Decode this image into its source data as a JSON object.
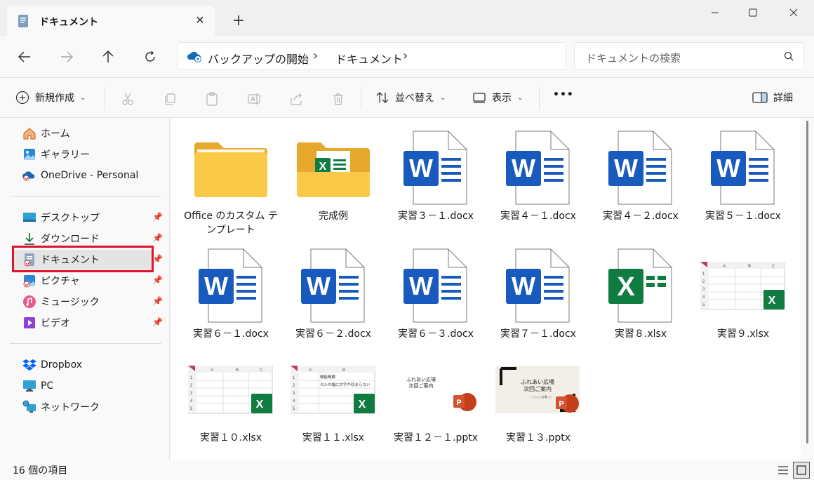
{
  "window": {
    "tab_title": "ドキュメント",
    "tab_close": "✕",
    "new_tab": "+"
  },
  "nav": {
    "breadcrumb": [
      "バックアップの開始",
      "ドキュメント"
    ],
    "search_placeholder": "ドキュメントの検索"
  },
  "toolbar": {
    "new_label": "新規作成",
    "sort_label": "並べ替え",
    "view_label": "表示",
    "more_label": "•••",
    "details_label": "詳細"
  },
  "sidebar": {
    "top": [
      {
        "label": "ホーム",
        "icon": "home-icon"
      },
      {
        "label": "ギャラリー",
        "icon": "gallery-icon"
      },
      {
        "label": "OneDrive - Personal",
        "icon": "onedrive-icon"
      }
    ],
    "pinned": [
      {
        "label": "デスクトップ",
        "icon": "desktop-icon"
      },
      {
        "label": "ダウンロード",
        "icon": "download-icon"
      },
      {
        "label": "ドキュメント",
        "icon": "documents-icon"
      },
      {
        "label": "ピクチャ",
        "icon": "pictures-icon"
      },
      {
        "label": "ミュージック",
        "icon": "music-icon"
      },
      {
        "label": "ビデオ",
        "icon": "video-icon"
      }
    ],
    "bottom": [
      {
        "label": "Dropbox",
        "icon": "dropbox-icon"
      },
      {
        "label": "PC",
        "icon": "pc-icon"
      },
      {
        "label": "ネットワーク",
        "icon": "network-icon"
      }
    ],
    "selected": "ドキュメント"
  },
  "files": [
    {
      "name": "Office のカスタム テンプレート",
      "type": "folder"
    },
    {
      "name": "完成例",
      "type": "folder-excel"
    },
    {
      "name": "実習３－１.docx",
      "type": "word"
    },
    {
      "name": "実習４－１.docx",
      "type": "word"
    },
    {
      "name": "実習４－２.docx",
      "type": "word"
    },
    {
      "name": "実習５－１.docx",
      "type": "word"
    },
    {
      "name": "実習６－１.docx",
      "type": "word"
    },
    {
      "name": "実習６－２.docx",
      "type": "word"
    },
    {
      "name": "実習６－３.docx",
      "type": "word"
    },
    {
      "name": "実習７－１.docx",
      "type": "word"
    },
    {
      "name": "実習８.xlsx",
      "type": "excel"
    },
    {
      "name": "実習９.xlsx",
      "type": "excel-thumb"
    },
    {
      "name": "実習１０.xlsx",
      "type": "excel-thumb"
    },
    {
      "name": "実習１１.xlsx",
      "type": "excel-thumb-text"
    },
    {
      "name": "実習１２－１.pptx",
      "type": "ppt-thumb"
    },
    {
      "name": "実習１３.pptx",
      "type": "ppt-thumb-frame"
    }
  ],
  "thumb_text": {
    "excel_cols": [
      "A",
      "B",
      "C"
    ],
    "excel_rows": [
      "1",
      "2",
      "3",
      "4",
      "5"
    ],
    "excel11_line1": "機能概要",
    "excel11_line2": "セルの幅に文字が収まらない",
    "ppt_title1": "ふれあい広場",
    "ppt_title2": "次回ご案内",
    "ppt_sub": "○○○○会場○○"
  },
  "status": {
    "count": "16 個の項目"
  },
  "colors": {
    "word_blue": "#185abd",
    "excel_green": "#107c41",
    "ppt_red": "#c43e1c",
    "folder_yellow": "#f5c242",
    "highlight_red": "#e0132d"
  }
}
